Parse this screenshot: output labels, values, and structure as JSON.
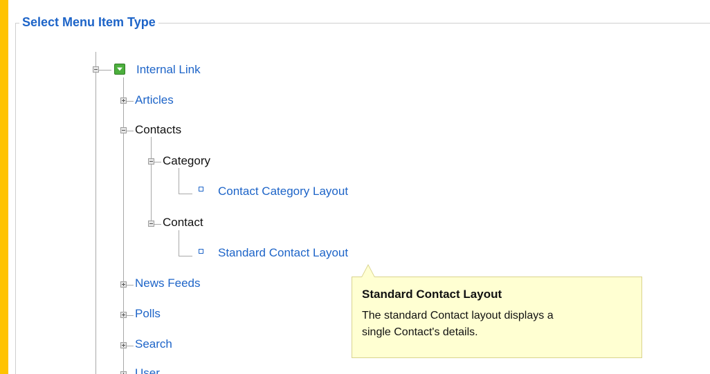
{
  "legend": "Select Menu Item Type",
  "tree": {
    "root": "Internal Link",
    "articles": "Articles",
    "contacts": "Contacts",
    "category": "Category",
    "contact_category_layout": "Contact Category Layout",
    "contact": "Contact",
    "standard_contact_layout": "Standard Contact Layout",
    "news_feeds": "News Feeds",
    "polls": "Polls",
    "search": "Search",
    "user": "User"
  },
  "tooltip": {
    "title": "Standard Contact Layout",
    "description_line1": "The standard Contact layout displays a",
    "description_line2": "single Contact's details."
  },
  "colors": {
    "frame": "#FFC300",
    "link": "#1d64c8",
    "tooltip_bg": "#ffffd2"
  }
}
